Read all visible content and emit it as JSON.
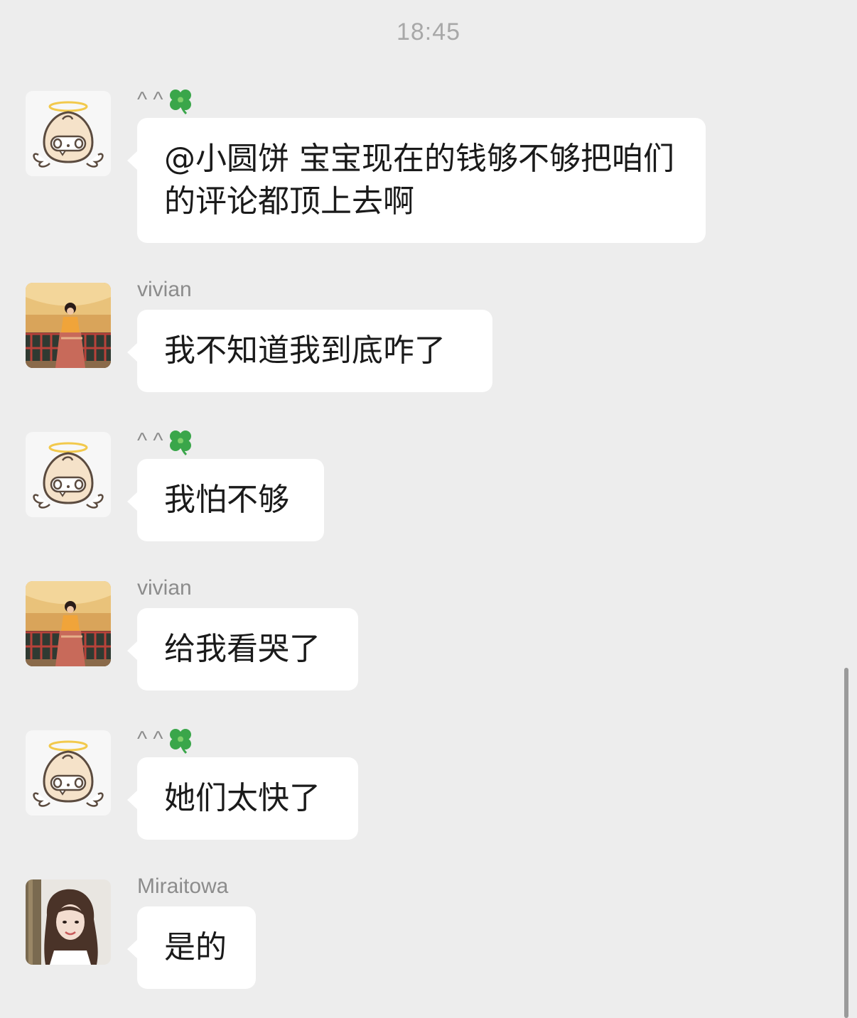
{
  "timestamp": "18:45",
  "messages": [
    {
      "sender": "^ ^",
      "sender_icon": "four-leaf-clover-icon",
      "avatar": "angel-mascot-avatar",
      "text": "@小圆饼 宝宝现在的钱够不够把咱们的评论都顶上去啊"
    },
    {
      "sender": "vivian",
      "avatar": "vivian-photo-avatar",
      "text": "我不知道我到底咋了"
    },
    {
      "sender": "^ ^",
      "sender_icon": "four-leaf-clover-icon",
      "avatar": "angel-mascot-avatar",
      "text": "我怕不够"
    },
    {
      "sender": "vivian",
      "avatar": "vivian-photo-avatar",
      "text": "给我看哭了"
    },
    {
      "sender": "^ ^",
      "sender_icon": "four-leaf-clover-icon",
      "avatar": "angel-mascot-avatar",
      "text": "她们太快了"
    },
    {
      "sender": "Miraitowa",
      "avatar": "miraitowa-photo-avatar",
      "text": "是的"
    }
  ],
  "colors": {
    "background": "#ededed",
    "bubble": "#ffffff",
    "sender_name": "#8c8c8c",
    "timestamp": "#a8a8a8"
  }
}
